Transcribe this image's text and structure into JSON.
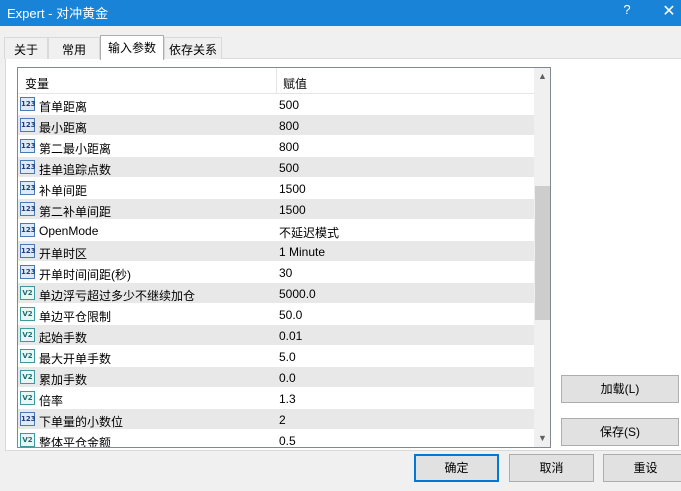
{
  "window": {
    "title": "Expert - 对冲黄金",
    "help_label": "?",
    "close_label": "✕"
  },
  "tabs": [
    "关于",
    "常用",
    "输入参数",
    "依存关系"
  ],
  "active_tab": 2,
  "grid": {
    "header": {
      "name_col": "变量",
      "value_col": "赋值"
    },
    "rows": [
      {
        "icon": "123",
        "name": "首单距离",
        "value": "500"
      },
      {
        "icon": "123",
        "name": "最小距离",
        "value": "800"
      },
      {
        "icon": "123",
        "name": "第二最小距离",
        "value": "800"
      },
      {
        "icon": "123",
        "name": "挂单追踪点数",
        "value": "500"
      },
      {
        "icon": "123",
        "name": "补单间距",
        "value": "1500"
      },
      {
        "icon": "123",
        "name": "第二补单间距",
        "value": "1500"
      },
      {
        "icon": "123",
        "name": "OpenMode",
        "value": "不延迟模式"
      },
      {
        "icon": "123",
        "name": "开单时区",
        "value": "1 Minute"
      },
      {
        "icon": "123",
        "name": "开单时间间距(秒)",
        "value": "30"
      },
      {
        "icon": "V2",
        "name": "单边浮亏超过多少不继续加仓",
        "value": "5000.0"
      },
      {
        "icon": "V2",
        "name": "单边平仓限制",
        "value": "50.0"
      },
      {
        "icon": "V2",
        "name": "起始手数",
        "value": "0.01"
      },
      {
        "icon": "V2",
        "name": "最大开单手数",
        "value": "5.0"
      },
      {
        "icon": "V2",
        "name": "累加手数",
        "value": "0.0"
      },
      {
        "icon": "V2",
        "name": "倍率",
        "value": "1.3"
      },
      {
        "icon": "123",
        "name": "下单量的小数位",
        "value": "2"
      },
      {
        "icon": "V2",
        "name": "整体平仓金额",
        "value": "0.5"
      }
    ]
  },
  "side_buttons": {
    "load": "加载(L)",
    "save": "保存(S)"
  },
  "footer_buttons": {
    "ok": "确定",
    "cancel": "取消",
    "reset": "重设"
  },
  "scrollbar": {
    "up_glyph": "▲",
    "down_glyph": "▼"
  }
}
